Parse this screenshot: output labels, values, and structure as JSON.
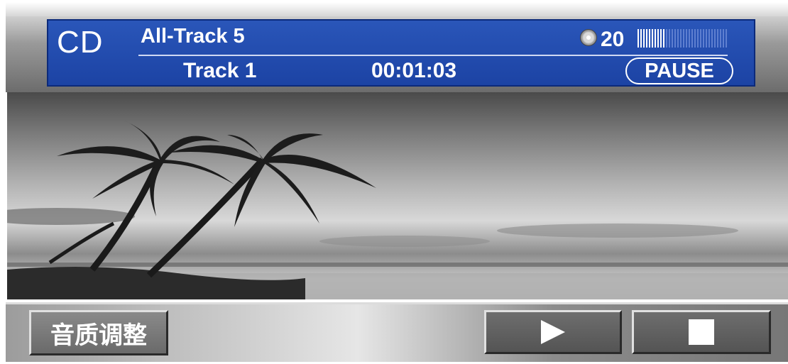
{
  "header": {
    "source": "CD",
    "mode": "All-Track 5",
    "track": "Track 1",
    "time": "00:01:03",
    "volume": "20",
    "volume_level_fraction": 0.3,
    "status": "PAUSE",
    "disc_icon": "disc-icon"
  },
  "controls": {
    "quality_label": "音质调整",
    "play_icon": "play-icon",
    "stop_icon": "stop-icon"
  },
  "colors": {
    "panel_blue": "#1f47a8",
    "text": "#ffffff",
    "button_gray": "#6a6a6a"
  }
}
